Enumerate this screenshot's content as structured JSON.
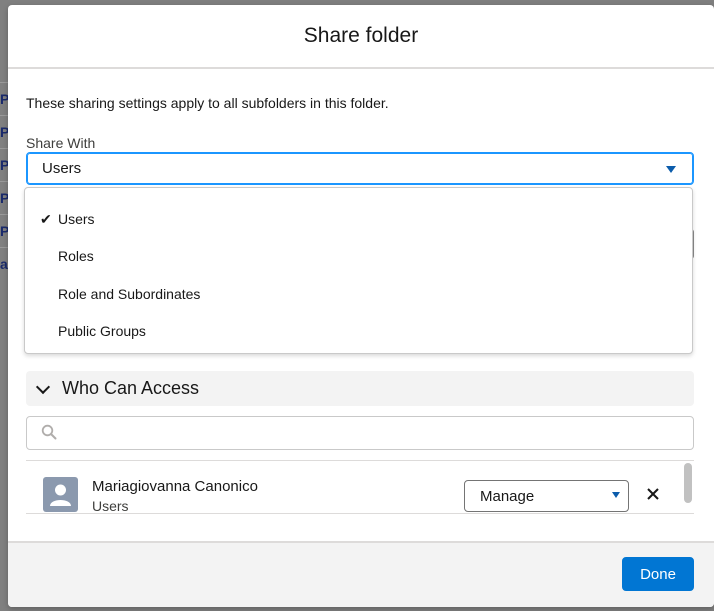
{
  "background": {
    "row_marks": [
      "P",
      "P",
      "P",
      "P",
      "P",
      "ar"
    ]
  },
  "modal": {
    "title": "Share folder",
    "description": "These sharing settings apply to all subfolders in this folder.",
    "share_with": {
      "label": "Share With",
      "selected": "Users",
      "options": [
        {
          "label": "Users",
          "checked": true
        },
        {
          "label": "Roles",
          "checked": false
        },
        {
          "label": "Role and Subordinates",
          "checked": false
        },
        {
          "label": "Public Groups",
          "checked": false
        }
      ]
    },
    "who_can_access": {
      "title": "Who Can Access",
      "search_placeholder": "",
      "entries": [
        {
          "name": "Mariagiovanna Canonico",
          "type": "Users",
          "access": "Manage"
        }
      ]
    },
    "footer": {
      "done_label": "Done"
    }
  },
  "colors": {
    "brand_blue": "#0176d3",
    "focus_blue": "#1b96ff",
    "caret_blue": "#0b5cab",
    "avatar_gray": "#8b99ae"
  },
  "icons": {
    "check": "checkmark-icon",
    "search": "search-icon",
    "remove": "close-icon",
    "avatar": "user-avatar-icon",
    "chevron": "chevron-down-icon"
  }
}
